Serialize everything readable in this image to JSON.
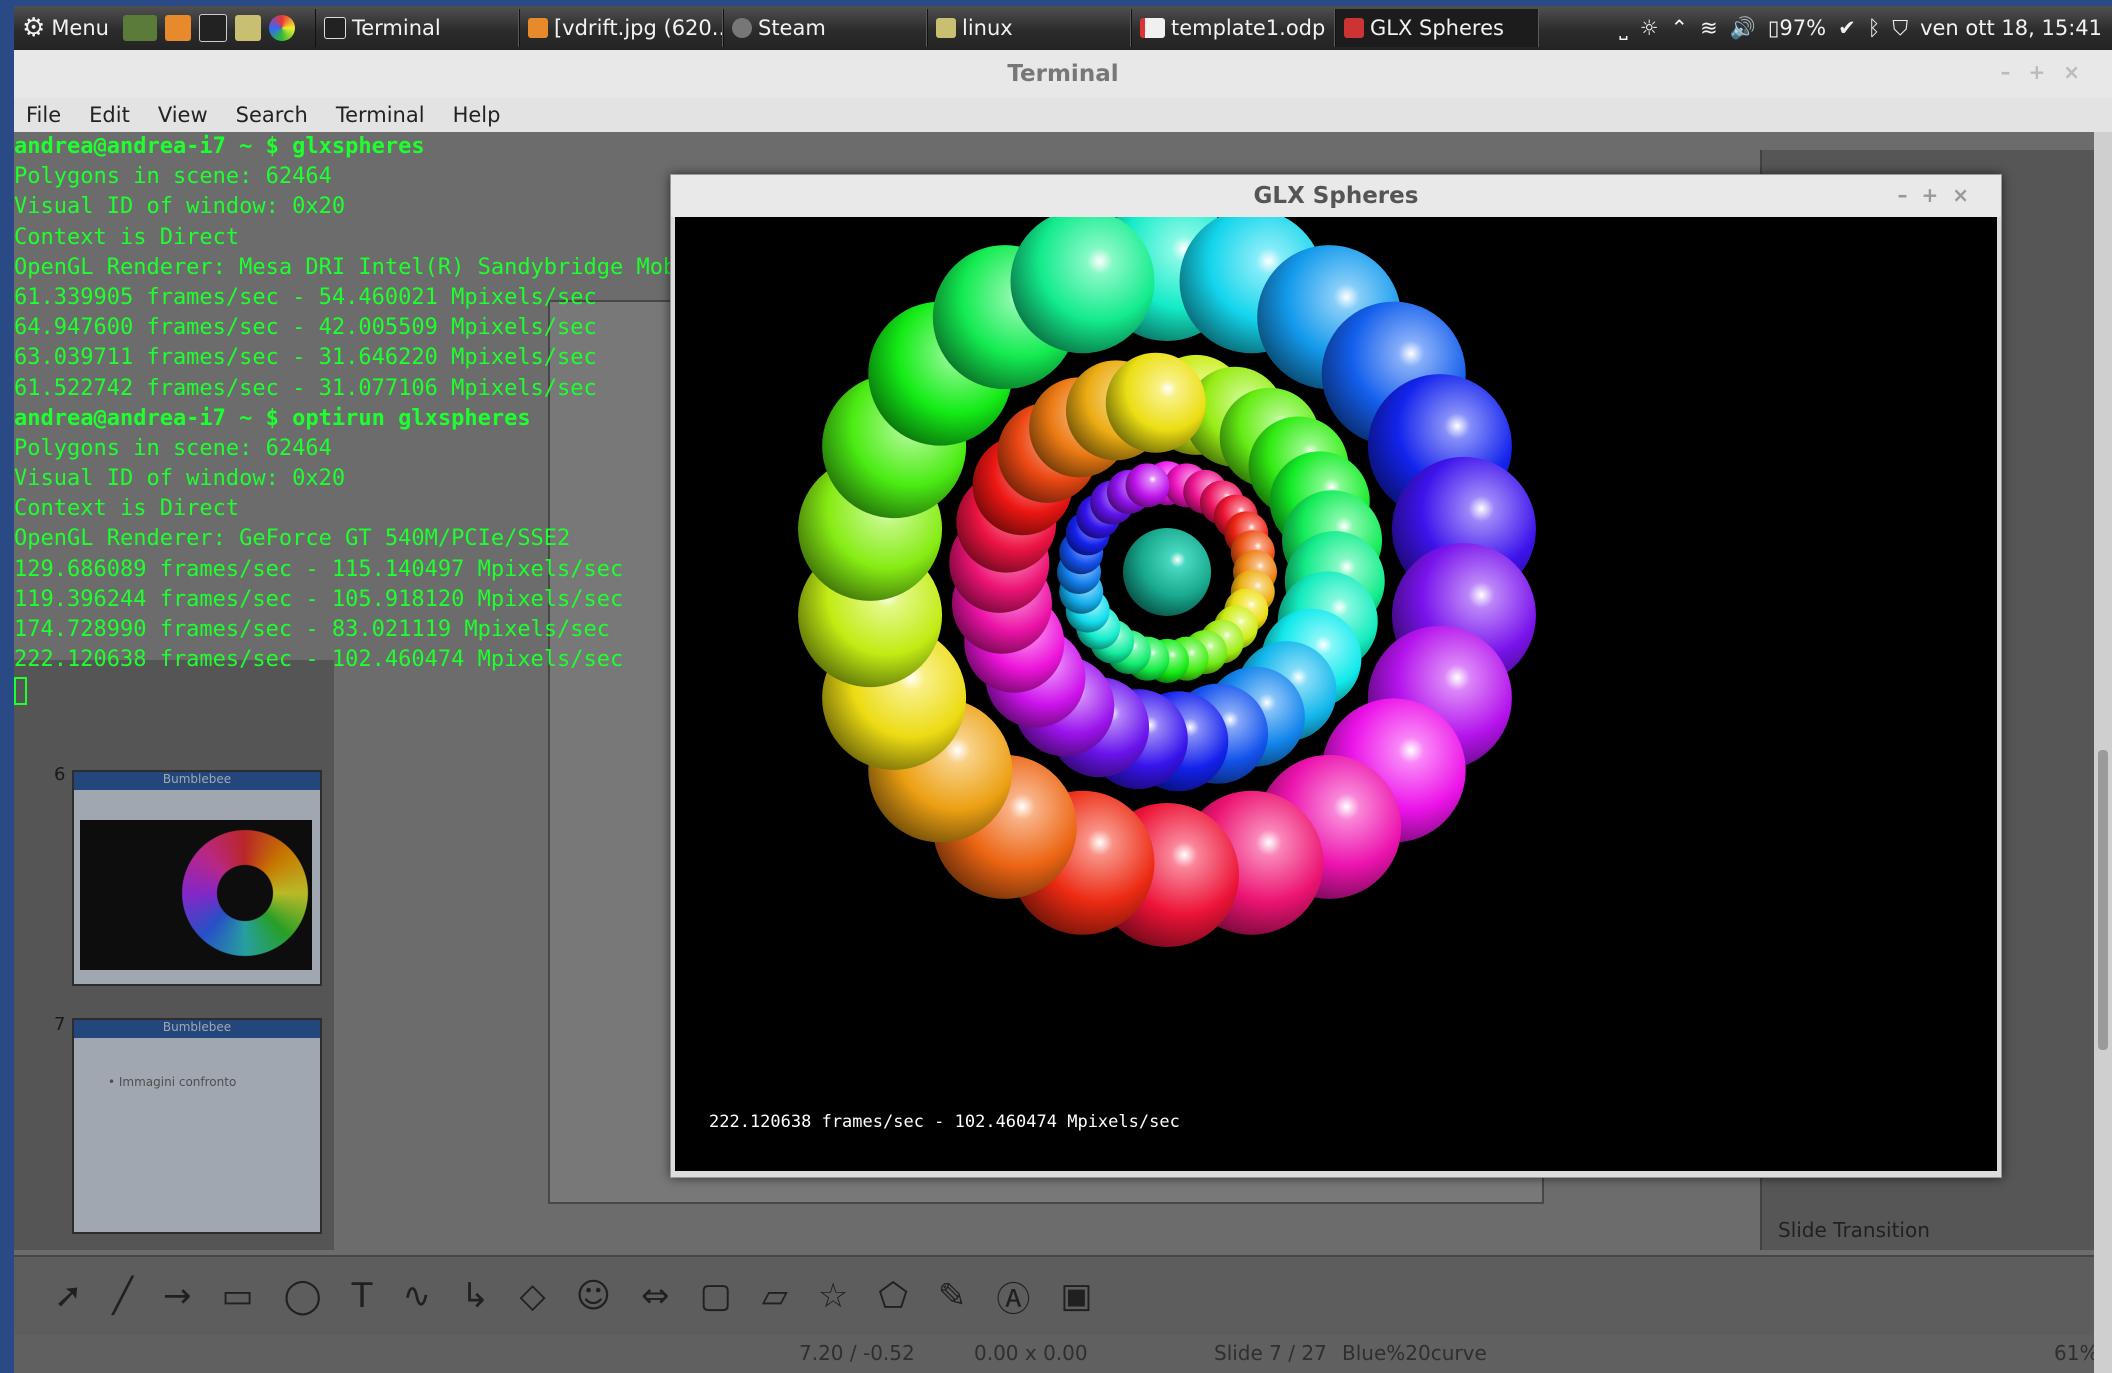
{
  "taskbar": {
    "menu_label": "Menu",
    "tasks": [
      {
        "label": "Terminal",
        "icon": "terminal-icon"
      },
      {
        "label": "[vdrift.jpg (620...",
        "icon": "image-viewer-icon"
      },
      {
        "label": "Steam",
        "icon": "steam-icon"
      },
      {
        "label": "linux",
        "icon": "folder-icon"
      },
      {
        "label": "template1.odp ...",
        "icon": "impress-document-icon"
      },
      {
        "label": "GLX Spheres",
        "icon": "glx-app-icon"
      }
    ],
    "battery": "97%",
    "clock": "ven ott 18, 15:41"
  },
  "terminal": {
    "title": "Terminal",
    "menu": [
      "File",
      "Edit",
      "View",
      "Search",
      "Terminal",
      "Help"
    ],
    "lines": [
      {
        "text": "andrea@andrea-i7 ~ $ glxspheres",
        "prompt": true
      },
      {
        "text": "Polygons in scene: 62464"
      },
      {
        "text": "Visual ID of window: 0x20"
      },
      {
        "text": "Context is Direct"
      },
      {
        "text": "OpenGL Renderer: Mesa DRI Intel(R) Sandybridge Mobile"
      },
      {
        "text": "61.339905 frames/sec - 54.460021 Mpixels/sec"
      },
      {
        "text": "64.947600 frames/sec - 42.005509 Mpixels/sec"
      },
      {
        "text": "63.039711 frames/sec - 31.646220 Mpixels/sec"
      },
      {
        "text": "61.522742 frames/sec - 31.077106 Mpixels/sec"
      },
      {
        "text": "andrea@andrea-i7 ~ $ optirun glxspheres",
        "prompt": true
      },
      {
        "text": "Polygons in scene: 62464"
      },
      {
        "text": "Visual ID of window: 0x20"
      },
      {
        "text": "Context is Direct"
      },
      {
        "text": "OpenGL Renderer: GeForce GT 540M/PCIe/SSE2"
      },
      {
        "text": "129.686089 frames/sec - 115.140497 Mpixels/sec"
      },
      {
        "text": "119.396244 frames/sec - 105.918120 Mpixels/sec"
      },
      {
        "text": "174.728990 frames/sec - 83.021119 Mpixels/sec"
      },
      {
        "text": "222.120638 frames/sec - 102.460474 Mpixels/sec"
      }
    ]
  },
  "glx": {
    "title": "GLX Spheres",
    "fps_text": "222.120638 frames/sec - 102.460474 Mpixels/sec",
    "rings": [
      {
        "count": 22
      },
      {
        "count": 26
      },
      {
        "count": 28
      },
      {
        "count": 1
      }
    ]
  },
  "impress": {
    "slide_transition": "Slide Transition",
    "status_position": "7.20 / -0.52",
    "status_size": "0.00 x 0.00",
    "status_slide": "Slide 7 / 27",
    "status_master": "Blue%20curve",
    "status_zoom": "61%",
    "thumbnails": [
      {
        "number": "6",
        "title": "Bumblebee"
      },
      {
        "number": "7",
        "title": "Bumblebee",
        "bullet": "• Immagini confronto"
      }
    ]
  }
}
